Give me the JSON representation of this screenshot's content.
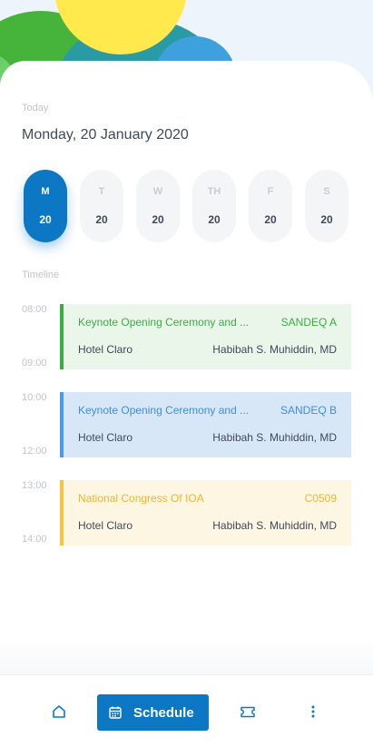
{
  "header": {
    "today_label": "Today",
    "date_title": "Monday, 20 January 2020"
  },
  "day_picker": {
    "days": [
      {
        "abbr": "M",
        "num": "20",
        "selected": true
      },
      {
        "abbr": "T",
        "num": "20",
        "selected": false
      },
      {
        "abbr": "W",
        "num": "20",
        "selected": false
      },
      {
        "abbr": "TH",
        "num": "20",
        "selected": false
      },
      {
        "abbr": "F",
        "num": "20",
        "selected": false
      },
      {
        "abbr": "S",
        "num": "20",
        "selected": false
      }
    ]
  },
  "timeline": {
    "label": "Timeline",
    "events": [
      {
        "start": "08:00",
        "end": "09:00",
        "title": "Keynote Opening Ceremony and ...",
        "code": "SANDEQ A",
        "place": "Hotel Claro",
        "person": "Habibah S. Muhiddin, MD",
        "color": "#3cab43"
      },
      {
        "start": "10:00",
        "end": "12:00",
        "title": "Keynote Opening Ceremony and ...",
        "code": "SANDEQ B",
        "place": "Hotel Claro",
        "person": "Habibah S. Muhiddin, MD",
        "color": "#4a9ae8"
      },
      {
        "start": "13:00",
        "end": "14:00",
        "title": "National Congress Of IOA",
        "code": "C0509",
        "place": "Hotel Claro",
        "person": "Habibah S. Muhiddin, MD",
        "color": "#f5c445"
      }
    ]
  },
  "bottom_nav": {
    "home_icon": "home-icon",
    "schedule_icon": "calendar-icon",
    "schedule_label": "Schedule",
    "ticket_icon": "ticket-icon",
    "more_icon": "more-vertical-icon",
    "accent": "#0c78c4"
  }
}
